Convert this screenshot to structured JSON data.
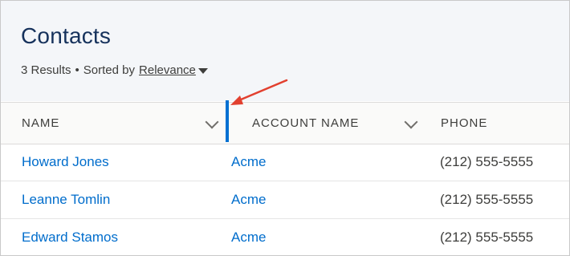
{
  "header": {
    "title": "Contacts",
    "result_count": "3 Results",
    "separator": "•",
    "sorted_by_label": "Sorted by",
    "sort_field": "Relevance"
  },
  "table": {
    "columns": [
      "NAME",
      "ACCOUNT NAME",
      "PHONE"
    ],
    "rows": [
      {
        "name": "Howard Jones",
        "account": "Acme",
        "phone": "(212) 555-5555"
      },
      {
        "name": "Leanne Tomlin",
        "account": "Acme",
        "phone": "(212) 555-5555"
      },
      {
        "name": "Edward Stamos",
        "account": "Acme",
        "phone": "(212) 555-5555"
      }
    ]
  },
  "colors": {
    "link": "#006dcc",
    "resize_handle": "#0070d2",
    "annotation_arrow": "#e2402f"
  },
  "icons": {
    "sort_caret": "caret-down-icon",
    "column_menu": "chevron-down-icon",
    "annotation": "arrow-icon"
  }
}
